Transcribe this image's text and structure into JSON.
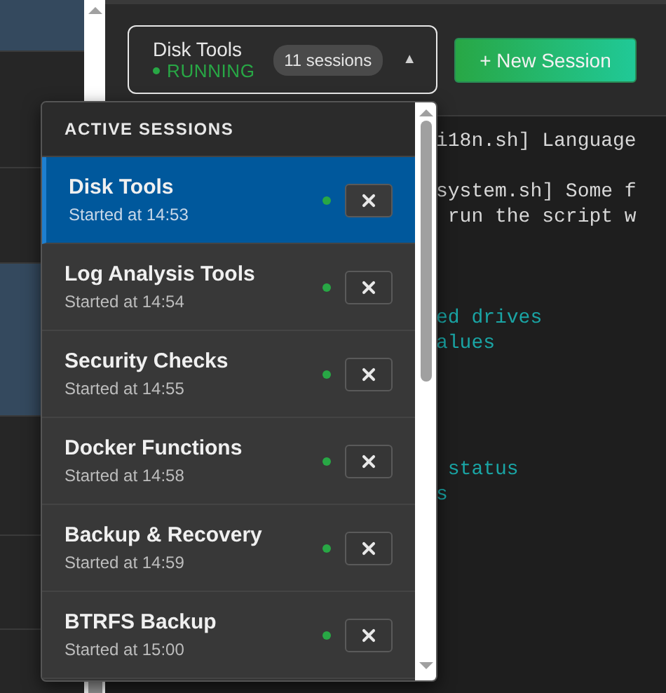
{
  "session_selector": {
    "name": "Disk Tools",
    "status": "RUNNING",
    "running": true,
    "count": "11 sessions",
    "caret": "▲",
    "expanded": true
  },
  "new_session_button": {
    "label": "+ New Session"
  },
  "terminal": {
    "lines": [
      {
        "text": "i18n.sh] Language",
        "kind": "plain"
      },
      {
        "kind": "blank"
      },
      {
        "text": "system.sh] Some f",
        "kind": "plain"
      },
      {
        "text": " run the script w",
        "kind": "plain"
      },
      {
        "kind": "blank"
      },
      {
        "kind": "blank"
      },
      {
        "kind": "blank"
      },
      {
        "text": "ed drives",
        "kind": "accent"
      },
      {
        "text": "alues",
        "kind": "accent"
      },
      {
        "kind": "blank"
      },
      {
        "kind": "blank"
      },
      {
        "kind": "blank"
      },
      {
        "kind": "blank"
      },
      {
        "text": " status",
        "kind": "accent"
      },
      {
        "text": "s",
        "kind": "accent"
      }
    ]
  },
  "dropdown": {
    "title": "ACTIVE SESSIONS",
    "sessions": [
      {
        "name": "Disk Tools",
        "started": "Started at 14:53",
        "selected": true,
        "running": true
      },
      {
        "name": "Log Analysis Tools",
        "started": "Started at 14:54",
        "selected": false,
        "running": true
      },
      {
        "name": "Security Checks",
        "started": "Started at 14:55",
        "selected": false,
        "running": true
      },
      {
        "name": "Docker Functions",
        "started": "Started at 14:58",
        "selected": false,
        "running": true
      },
      {
        "name": "Backup & Recovery",
        "started": "Started at 14:59",
        "selected": false,
        "running": true
      },
      {
        "name": "BTRFS Backup",
        "started": "Started at 15:00",
        "selected": false,
        "running": true
      }
    ]
  }
}
